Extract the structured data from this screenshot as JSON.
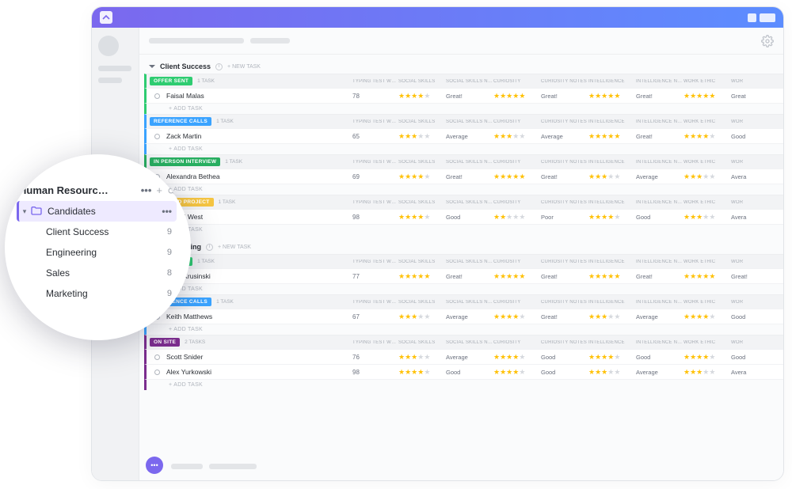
{
  "columns": [
    "TYPING TEST WPM",
    "SOCIAL SKILLS",
    "SOCIAL SKILLS NOTES",
    "CURIOSITY",
    "CURIOSITY NOTES",
    "INTELLIGENCE",
    "INTELLIGENCE NOTES",
    "WORK ETHIC",
    "WOR"
  ],
  "add_task_label": "+ ADD TASK",
  "new_task_label": "+ NEW TASK",
  "sections": [
    {
      "name": "Client Success",
      "groups": [
        {
          "status": "OFFER SENT",
          "color": "#2ecc71",
          "ntasks": "1 TASK",
          "rows": [
            {
              "name": "Faisal Malas",
              "wpm": "78",
              "r1": 4,
              "n1": "Great!",
              "r2": 5,
              "n2": "Great!",
              "r3": 5,
              "n3": "Great!",
              "r4": 5,
              "n4": "Great"
            }
          ]
        },
        {
          "status": "REFERENCE CALLS",
          "color": "#3aa3ff",
          "ntasks": "1 TASK",
          "rows": [
            {
              "name": "Zack Martin",
              "wpm": "65",
              "r1": 3,
              "n1": "Average",
              "r2": 3,
              "n2": "Average",
              "r3": 5,
              "n3": "Great!",
              "r4": 4,
              "n4": "Good"
            }
          ]
        },
        {
          "status": "IN PERSON INTERVIEW",
          "color": "#27ae60",
          "ntasks": "1 TASK",
          "rows": [
            {
              "name": "Alexandra Bethea",
              "wpm": "69",
              "r1": 4,
              "n1": "Great!",
              "r2": 5,
              "n2": "Great!",
              "r3": 3,
              "n3": "Average",
              "r4": 3,
              "n4": "Avera"
            }
          ]
        },
        {
          "status": "RECEIVED PROJECT",
          "color": "#f5c542",
          "ntasks": "1 TASK",
          "rows": [
            {
              "name": "Brandi West",
              "wpm": "98",
              "r1": 4,
              "n1": "Good",
              "r2": 2,
              "n2": "Poor",
              "r3": 4,
              "n3": "Good",
              "r4": 3,
              "n4": "Avera"
            }
          ]
        }
      ]
    },
    {
      "name": "Engineering",
      "groups": [
        {
          "status": "OFFER SENT",
          "color": "#2ecc71",
          "ntasks": "1 TASK",
          "rows": [
            {
              "name": "Jerry Krusinski",
              "wpm": "77",
              "r1": 5,
              "n1": "Great!",
              "r2": 5,
              "n2": "Great!",
              "r3": 5,
              "n3": "Great!",
              "r4": 5,
              "n4": "Great!"
            }
          ]
        },
        {
          "status": "REFERENCE CALLS",
          "color": "#3aa3ff",
          "ntasks": "1 TASK",
          "rows": [
            {
              "name": "Keith Matthews",
              "wpm": "67",
              "r1": 3,
              "n1": "Average",
              "r2": 4,
              "n2": "Great!",
              "r3": 3,
              "n3": "Average",
              "r4": 4,
              "n4": "Good"
            }
          ]
        },
        {
          "status": "ON SITE",
          "color": "#7b2d8e",
          "ntasks": "2 TASKS",
          "rows": [
            {
              "name": "Scott Snider",
              "wpm": "76",
              "r1": 3,
              "n1": "Average",
              "r2": 4,
              "n2": "Good",
              "r3": 4,
              "n3": "Good",
              "r4": 4,
              "n4": "Good"
            },
            {
              "name": "Alex Yurkowski",
              "wpm": "98",
              "r1": 4,
              "n1": "Good",
              "r2": 4,
              "n2": "Good",
              "r3": 3,
              "n3": "Average",
              "r4": 3,
              "n4": "Avera"
            }
          ]
        }
      ]
    }
  ],
  "magnifier": {
    "title": "Human Resourc…",
    "active": "Candidates",
    "items": [
      {
        "label": "Client Success",
        "count": "9"
      },
      {
        "label": "Engineering",
        "count": "9"
      },
      {
        "label": "Sales",
        "count": "8"
      },
      {
        "label": "Marketing",
        "count": "9"
      }
    ]
  }
}
